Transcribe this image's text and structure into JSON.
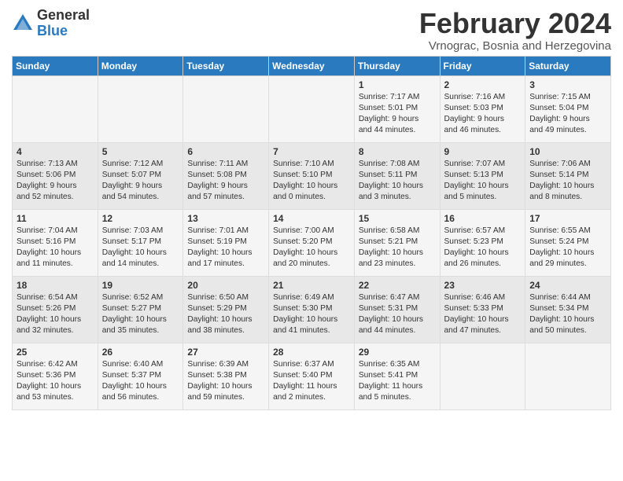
{
  "header": {
    "logo_general": "General",
    "logo_blue": "Blue",
    "month_title": "February 2024",
    "location": "Vrnograc, Bosnia and Herzegovina"
  },
  "days_of_week": [
    "Sunday",
    "Monday",
    "Tuesday",
    "Wednesday",
    "Thursday",
    "Friday",
    "Saturday"
  ],
  "weeks": [
    [
      {
        "day": "",
        "info": ""
      },
      {
        "day": "",
        "info": ""
      },
      {
        "day": "",
        "info": ""
      },
      {
        "day": "",
        "info": ""
      },
      {
        "day": "1",
        "info": "Sunrise: 7:17 AM\nSunset: 5:01 PM\nDaylight: 9 hours\nand 44 minutes."
      },
      {
        "day": "2",
        "info": "Sunrise: 7:16 AM\nSunset: 5:03 PM\nDaylight: 9 hours\nand 46 minutes."
      },
      {
        "day": "3",
        "info": "Sunrise: 7:15 AM\nSunset: 5:04 PM\nDaylight: 9 hours\nand 49 minutes."
      }
    ],
    [
      {
        "day": "4",
        "info": "Sunrise: 7:13 AM\nSunset: 5:06 PM\nDaylight: 9 hours\nand 52 minutes."
      },
      {
        "day": "5",
        "info": "Sunrise: 7:12 AM\nSunset: 5:07 PM\nDaylight: 9 hours\nand 54 minutes."
      },
      {
        "day": "6",
        "info": "Sunrise: 7:11 AM\nSunset: 5:08 PM\nDaylight: 9 hours\nand 57 minutes."
      },
      {
        "day": "7",
        "info": "Sunrise: 7:10 AM\nSunset: 5:10 PM\nDaylight: 10 hours\nand 0 minutes."
      },
      {
        "day": "8",
        "info": "Sunrise: 7:08 AM\nSunset: 5:11 PM\nDaylight: 10 hours\nand 3 minutes."
      },
      {
        "day": "9",
        "info": "Sunrise: 7:07 AM\nSunset: 5:13 PM\nDaylight: 10 hours\nand 5 minutes."
      },
      {
        "day": "10",
        "info": "Sunrise: 7:06 AM\nSunset: 5:14 PM\nDaylight: 10 hours\nand 8 minutes."
      }
    ],
    [
      {
        "day": "11",
        "info": "Sunrise: 7:04 AM\nSunset: 5:16 PM\nDaylight: 10 hours\nand 11 minutes."
      },
      {
        "day": "12",
        "info": "Sunrise: 7:03 AM\nSunset: 5:17 PM\nDaylight: 10 hours\nand 14 minutes."
      },
      {
        "day": "13",
        "info": "Sunrise: 7:01 AM\nSunset: 5:19 PM\nDaylight: 10 hours\nand 17 minutes."
      },
      {
        "day": "14",
        "info": "Sunrise: 7:00 AM\nSunset: 5:20 PM\nDaylight: 10 hours\nand 20 minutes."
      },
      {
        "day": "15",
        "info": "Sunrise: 6:58 AM\nSunset: 5:21 PM\nDaylight: 10 hours\nand 23 minutes."
      },
      {
        "day": "16",
        "info": "Sunrise: 6:57 AM\nSunset: 5:23 PM\nDaylight: 10 hours\nand 26 minutes."
      },
      {
        "day": "17",
        "info": "Sunrise: 6:55 AM\nSunset: 5:24 PM\nDaylight: 10 hours\nand 29 minutes."
      }
    ],
    [
      {
        "day": "18",
        "info": "Sunrise: 6:54 AM\nSunset: 5:26 PM\nDaylight: 10 hours\nand 32 minutes."
      },
      {
        "day": "19",
        "info": "Sunrise: 6:52 AM\nSunset: 5:27 PM\nDaylight: 10 hours\nand 35 minutes."
      },
      {
        "day": "20",
        "info": "Sunrise: 6:50 AM\nSunset: 5:29 PM\nDaylight: 10 hours\nand 38 minutes."
      },
      {
        "day": "21",
        "info": "Sunrise: 6:49 AM\nSunset: 5:30 PM\nDaylight: 10 hours\nand 41 minutes."
      },
      {
        "day": "22",
        "info": "Sunrise: 6:47 AM\nSunset: 5:31 PM\nDaylight: 10 hours\nand 44 minutes."
      },
      {
        "day": "23",
        "info": "Sunrise: 6:46 AM\nSunset: 5:33 PM\nDaylight: 10 hours\nand 47 minutes."
      },
      {
        "day": "24",
        "info": "Sunrise: 6:44 AM\nSunset: 5:34 PM\nDaylight: 10 hours\nand 50 minutes."
      }
    ],
    [
      {
        "day": "25",
        "info": "Sunrise: 6:42 AM\nSunset: 5:36 PM\nDaylight: 10 hours\nand 53 minutes."
      },
      {
        "day": "26",
        "info": "Sunrise: 6:40 AM\nSunset: 5:37 PM\nDaylight: 10 hours\nand 56 minutes."
      },
      {
        "day": "27",
        "info": "Sunrise: 6:39 AM\nSunset: 5:38 PM\nDaylight: 10 hours\nand 59 minutes."
      },
      {
        "day": "28",
        "info": "Sunrise: 6:37 AM\nSunset: 5:40 PM\nDaylight: 11 hours\nand 2 minutes."
      },
      {
        "day": "29",
        "info": "Sunrise: 6:35 AM\nSunset: 5:41 PM\nDaylight: 11 hours\nand 5 minutes."
      },
      {
        "day": "",
        "info": ""
      },
      {
        "day": "",
        "info": ""
      }
    ]
  ]
}
